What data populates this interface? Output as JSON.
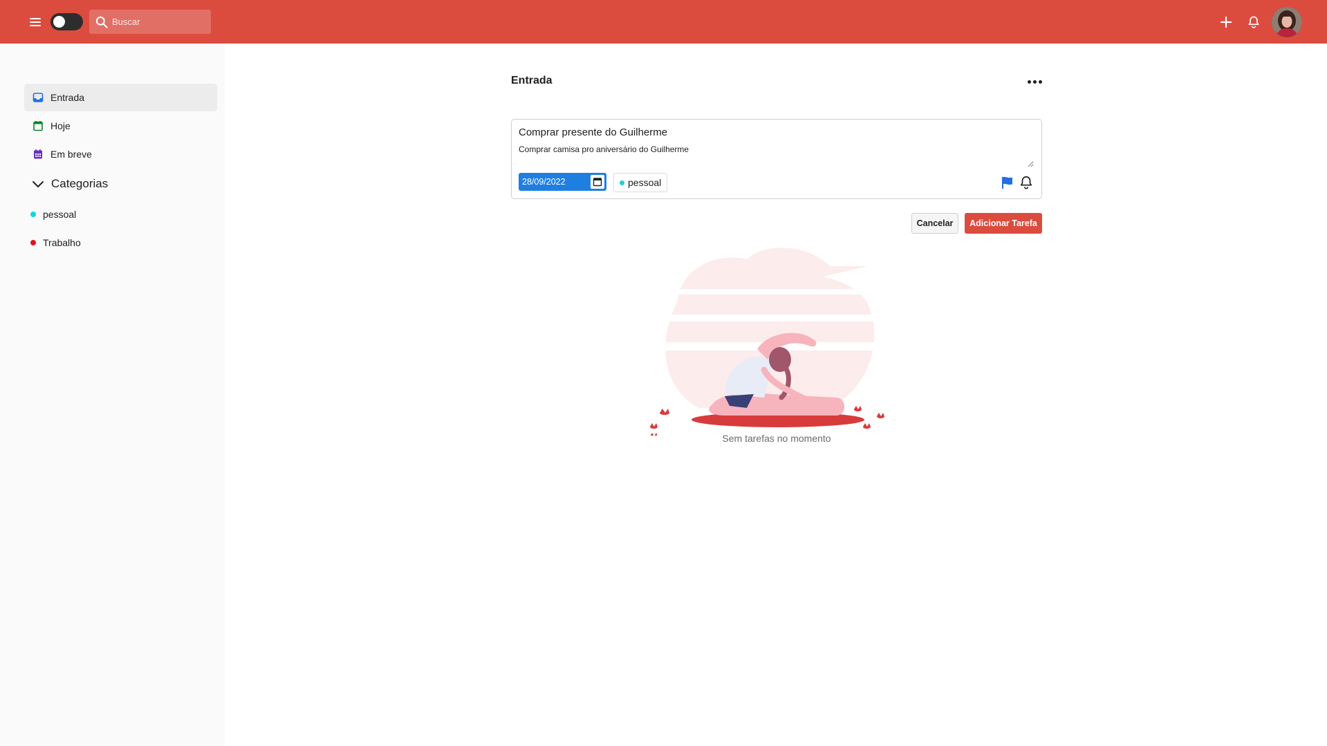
{
  "header": {
    "search_placeholder": "Buscar",
    "brand_color": "#db4c3f",
    "icons": [
      "menu-icon",
      "theme-toggle",
      "search-icon",
      "plus-icon",
      "bell-icon",
      "avatar"
    ]
  },
  "sidebar": {
    "items": [
      {
        "label": "Entrada",
        "icon": "inbox-icon",
        "color": "#246fe0",
        "active": true
      },
      {
        "label": "Hoje",
        "icon": "calendar-today-icon",
        "color": "#058527",
        "active": false
      },
      {
        "label": "Em breve",
        "icon": "calendar-upcoming-icon",
        "color": "#692fc2",
        "active": false
      }
    ],
    "categories_label": "Categorias",
    "categories": [
      {
        "label": "pessoal",
        "color": "#14d2de"
      },
      {
        "label": "Trabalho",
        "color": "#e8101a"
      }
    ]
  },
  "main": {
    "title": "Entrada",
    "editor": {
      "task_title": "Comprar presente do Guilherme",
      "task_description": "Comprar camisa pro aniversário do Guilherme",
      "date": "28/09/2022",
      "category": "pessoal",
      "category_color": "#14d2de",
      "priority_flag_color": "#246fe0"
    },
    "cancel_label": "Cancelar",
    "add_label": "Adicionar Tarefa",
    "empty_text": "Sem tarefas no momento"
  }
}
